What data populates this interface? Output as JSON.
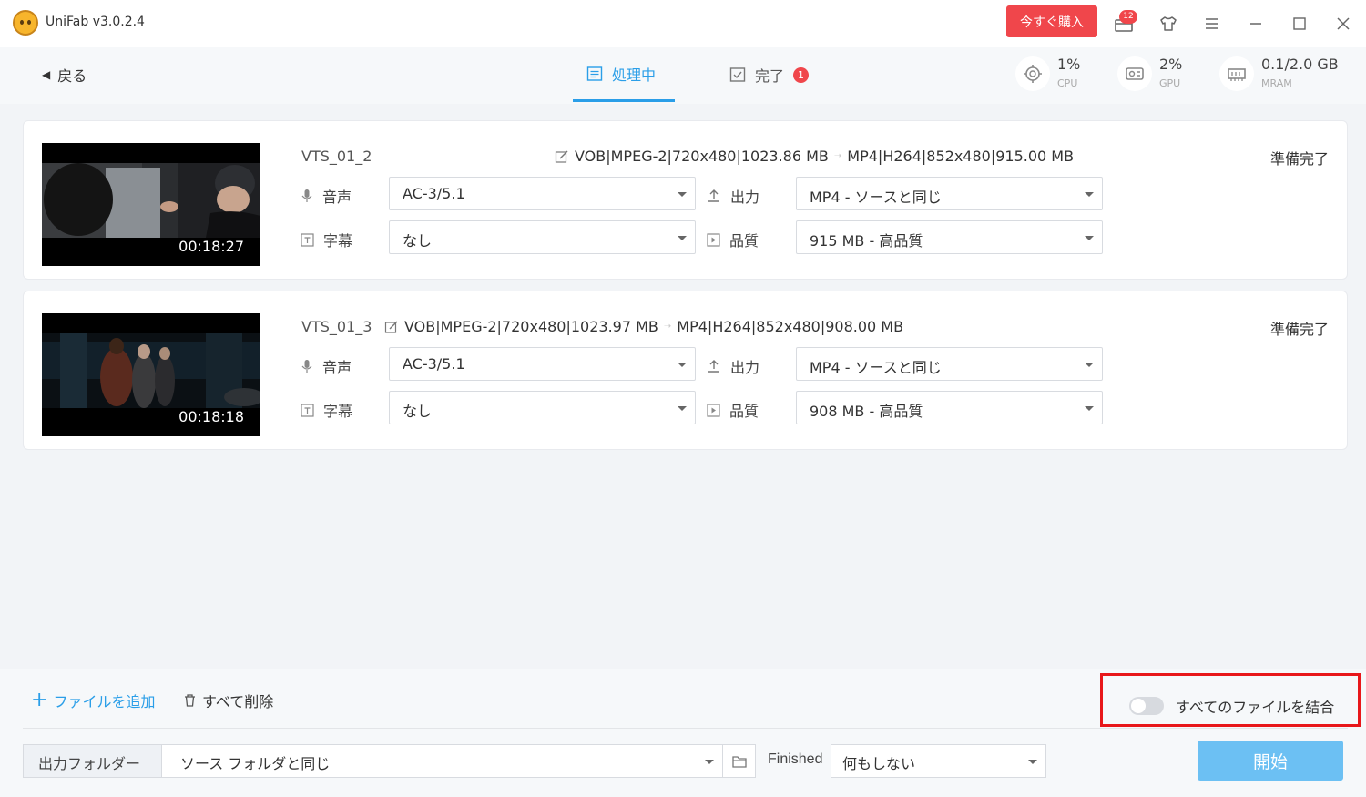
{
  "app": {
    "title": "UniFab v3.0.2.4",
    "buy_label": "今すぐ購入",
    "mail_count": "12"
  },
  "nav": {
    "back_label": "戻る",
    "tabs": [
      {
        "label": "処理中"
      },
      {
        "label": "完了",
        "badge": "1"
      }
    ]
  },
  "stats": {
    "cpu": {
      "value": "1%",
      "label": "CPU"
    },
    "gpu": {
      "value": "2%",
      "label": "GPU"
    },
    "vram": {
      "value": "0.1/2.0 GB",
      "label": "MRAM"
    }
  },
  "labels": {
    "audio": "音声",
    "subtitle": "字幕",
    "output": "出力",
    "quality": "品質"
  },
  "tasks": [
    {
      "title": "VTS_01_2",
      "duration": "00:18:27",
      "source": "VOB|MPEG-2|720x480|1023.86 MB",
      "target": "MP4|H264|852x480|915.00 MB",
      "status": "準備完了",
      "audio": "AC-3/5.1",
      "subtitle": "なし",
      "output": "MP4 - ソースと同じ",
      "quality": "915 MB - 高品質"
    },
    {
      "title": "VTS_01_3",
      "duration": "00:18:18",
      "source": "VOB|MPEG-2|720x480|1023.97 MB",
      "target": "MP4|H264|852x480|908.00 MB",
      "status": "準備完了",
      "audio": "AC-3/5.1",
      "subtitle": "なし",
      "output": "MP4 - ソースと同じ",
      "quality": "908 MB - 高品質"
    }
  ],
  "bottom": {
    "add_file": "ファイルを追加",
    "delete_all": "すべて削除",
    "merge_label": "すべてのファイルを結合",
    "merge_enabled": false,
    "output_folder_label": "出力フォルダー",
    "output_folder_value": "ソース フォルダと同じ",
    "finished_label": "Finished",
    "finished_value": "何もしない",
    "start_label": "開始"
  }
}
